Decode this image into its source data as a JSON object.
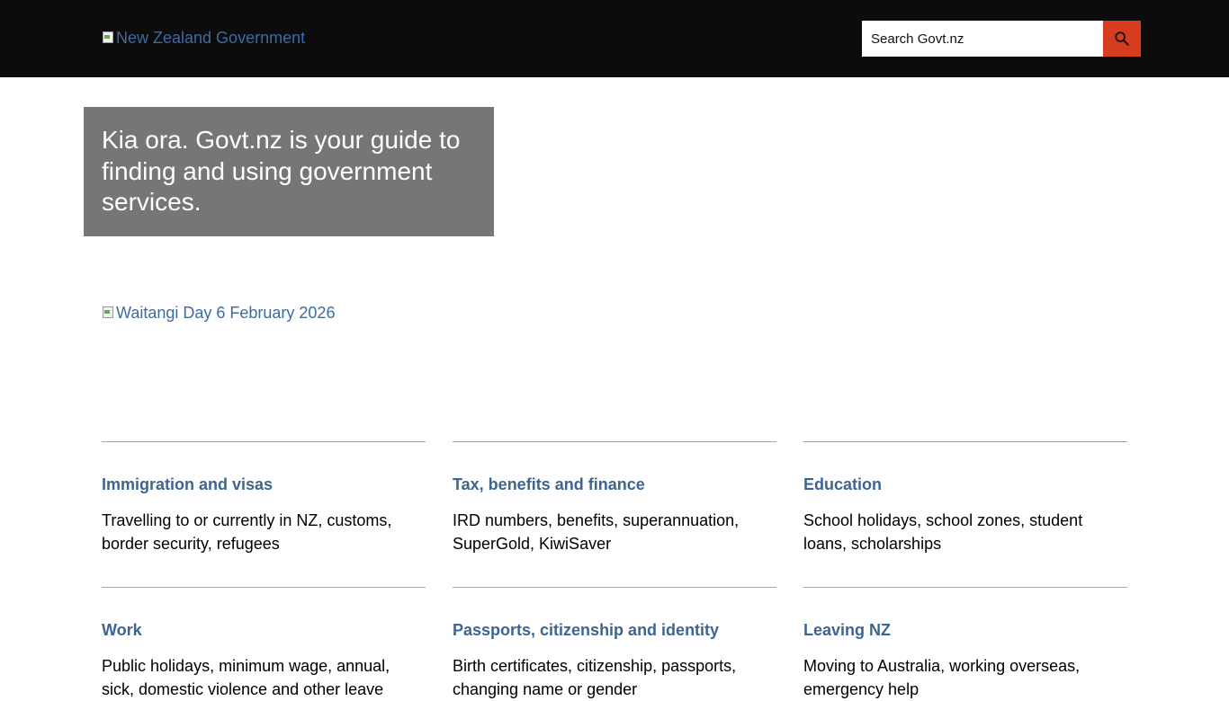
{
  "header": {
    "logo_alt": "New Zealand Government",
    "search": {
      "placeholder": "Search Govt.nz"
    },
    "search_button_icon": "search-icon"
  },
  "hero": {
    "text": "Kia ora. Govt.nz is your guide to finding and using government services."
  },
  "banner": {
    "alt": "Waitangi Day 6 February 2026"
  },
  "topics": [
    {
      "title": "Immigration and visas",
      "description": "Travelling to or currently in NZ, customs, border security, refugees"
    },
    {
      "title": "Tax, benefits and finance",
      "description": "IRD numbers, benefits, superannuation, SuperGold, KiwiSaver"
    },
    {
      "title": "Education",
      "description": "School holidays, school zones, student loans, scholarships"
    },
    {
      "title": "Work",
      "description": "Public holidays, minimum wage, annual, sick, domestic violence and other leave"
    },
    {
      "title": "Passports, citizenship and identity",
      "description": "Birth certificates, citizenship, passports, changing name or gender"
    },
    {
      "title": "Leaving NZ",
      "description": "Moving to Australia, working overseas, emergency help"
    }
  ],
  "colors": {
    "header_bg": "#0c0c0c",
    "search_button": "#d63d1f",
    "hero_bg": "#767676",
    "link": "#3d6591"
  }
}
